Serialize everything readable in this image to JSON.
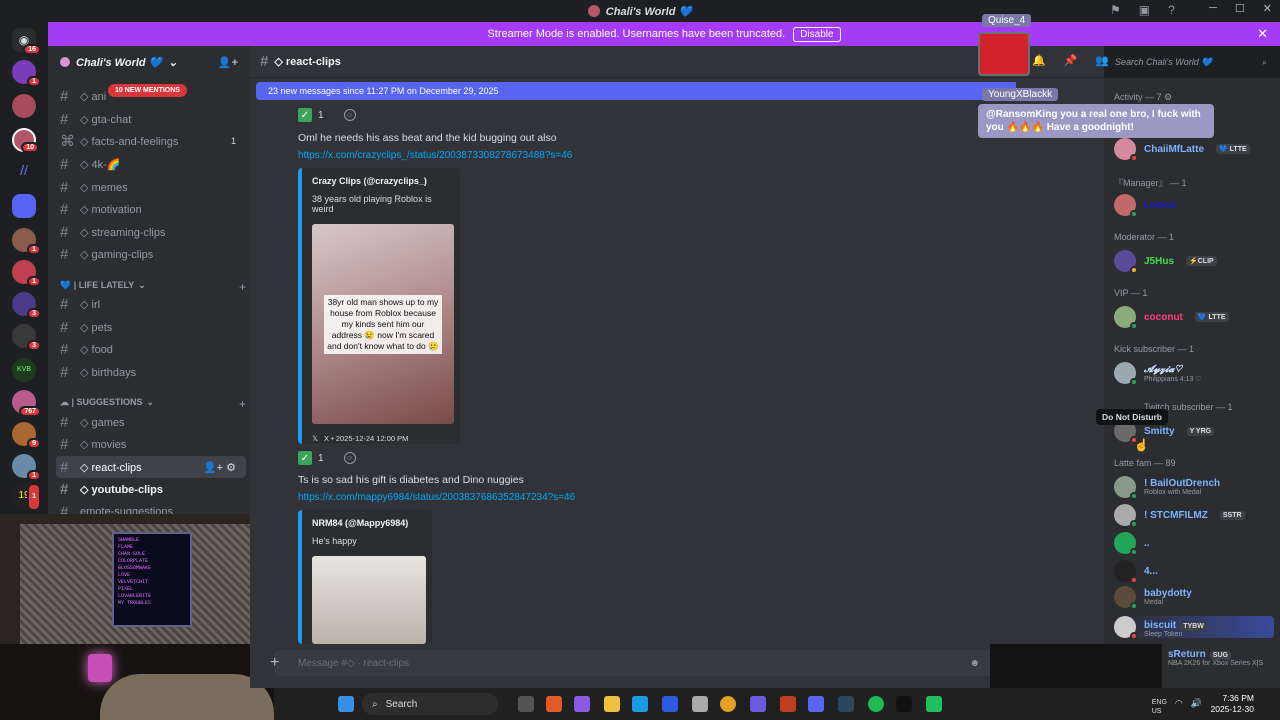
{
  "titlebar": {
    "title": "Chali's World 💙",
    "icons": [
      "⚑",
      "▣",
      "?"
    ],
    "controls": [
      "─",
      "☐",
      "✕"
    ]
  },
  "streamer": {
    "text": "Streamer Mode is enabled. Usernames have been truncated.",
    "disable_label": "Disable",
    "close": "✕"
  },
  "guilds": {
    "badges": [
      "16",
      "1",
      "10",
      "1",
      "1",
      "3",
      "3",
      "767",
      "9",
      "1",
      "1"
    ]
  },
  "server": {
    "name": "Chali's World 💙",
    "chevron": "⌄",
    "add": "👤+"
  },
  "mentions": "10 NEW MENTIONS",
  "channels": [
    {
      "name": "◇ ani",
      "count": ""
    },
    {
      "name": "◇ gta-chat",
      "count": ""
    },
    {
      "name": "◇ facts-and-feelings",
      "count": "1"
    },
    {
      "name": "◇ 4k-🌈",
      "count": ""
    },
    {
      "name": "◇ memes",
      "count": ""
    },
    {
      "name": "◇ motivation",
      "count": ""
    },
    {
      "name": "◇ streaming-clips",
      "count": ""
    },
    {
      "name": "◇ gaming-clips",
      "count": ""
    }
  ],
  "cat_life": "💙 | LIFE LATELY",
  "life_channels": [
    "◇ irl",
    "◇ pets",
    "◇ food",
    "◇ birthdays"
  ],
  "cat_suggestions": "☁ | SUGGESTIONS",
  "sugg_channels": [
    "◇ games",
    "◇ movies"
  ],
  "active_channel": "◇ react-clips",
  "more_channels": [
    "◇ youtube-clips",
    "emote-suggestions"
  ],
  "webcam": {
    "screen_lines": [
      "SHAMBLE",
      "FLAME",
      "CHAN SOLE",
      "COLORPLATE",
      "BLOSSOMWAKE",
      "LOVE",
      "VELVETCHIT",
      "PIXEL",
      "LOVABLEBITE",
      "MY TROUBLES"
    ]
  },
  "chat": {
    "channel": "◇ react-clips",
    "new_messages": "23 new messages since 11:27 PM on December 29, 2025"
  },
  "messages": [
    {
      "reaction_count": "1",
      "text": "Oml he needs his ass beat and the kid bugging out also",
      "link": "https://x.com/crazyclips_/status/2003873308278673488?s=46",
      "embed_author": "Crazy Clips (@crazyclips_)",
      "embed_desc": "38 years old playing Roblox is weird",
      "caption": "38yr old man shows up to my house from Roblox because my kinds sent him our address 😢 now I'm scared and don't know what to do 🥲",
      "footer_x": "𝕏",
      "footer": "X • 2025-12-24 12:00 PM"
    },
    {
      "reaction_count": "1",
      "text": "Ts is so sad his gift is diabetes and Dino nuggies",
      "link": "https://x.com/mappy6984/status/2003837686352847234?s=46",
      "embed_author": "NRM84 (@Mappy6984)",
      "embed_desc": "He's happy"
    }
  ],
  "input": {
    "placeholder": "Message #◇ · react-clips",
    "plus": "+",
    "emoji": "☻"
  },
  "header_icons": [
    "🔔",
    "📌",
    "👥"
  ],
  "search": {
    "placeholder": "Search Chali's World 💙",
    "icon": "⌕"
  },
  "members": {
    "activity": "Activity — 7 ⚙",
    "m1": {
      "name": "ChaiiMfLatte",
      "tag": "💙 LTTE"
    },
    "cat_manager": "『Manager』 — 1",
    "m2": {
      "name": "Lemon"
    },
    "cat_mod": "Moderator — 1",
    "m3": {
      "name": "J5Hus",
      "tag": "⚡CLIP"
    },
    "cat_vip": "VIP — 1",
    "m4": {
      "name": "coconut",
      "tag": "💙 LTTE"
    },
    "cat_kick": "Kick subscriber — 1",
    "m5": {
      "name": "𝓐𝔂𝔃𝓲𝓪♡",
      "sub": "Philippians 4:13 ♡"
    },
    "cat_twitch": "Twitch subscriber — 1",
    "m6": {
      "name": "Smitty",
      "tag": "Y YRG"
    },
    "cat_latte": "Latte fam — 89",
    "m7": {
      "name": "! BailOutDrench",
      "sub": "Roblox with Medal"
    },
    "m8": {
      "name": "! STCMFILMZ",
      "tag": "SSTR"
    },
    "m9": {
      "name": ".."
    },
    "m10": {
      "name": "4..."
    },
    "m11": {
      "name": "babydotty",
      "sub": "Medal"
    },
    "m12": {
      "name": "biscuit",
      "tag": "TYBW",
      "sub": "Sleep Token"
    },
    "m13": {
      "name": "sReturn",
      "tag": "SUG",
      "sub": "NBA 2K26 for Xbox Series X|S"
    }
  },
  "overlay": {
    "name1": "Quise_4",
    "name2": "YoungXBlackk",
    "message": "@RansomKing you a real one bro, I fuck with you 🔥🔥🔥 Have a goodnight!"
  },
  "tooltip": "Do Not Disturb",
  "taskbar": {
    "search": "Search",
    "time": "7:36 PM",
    "date": "2025-12-30",
    "lang": "ENG",
    "lang2": "US"
  }
}
